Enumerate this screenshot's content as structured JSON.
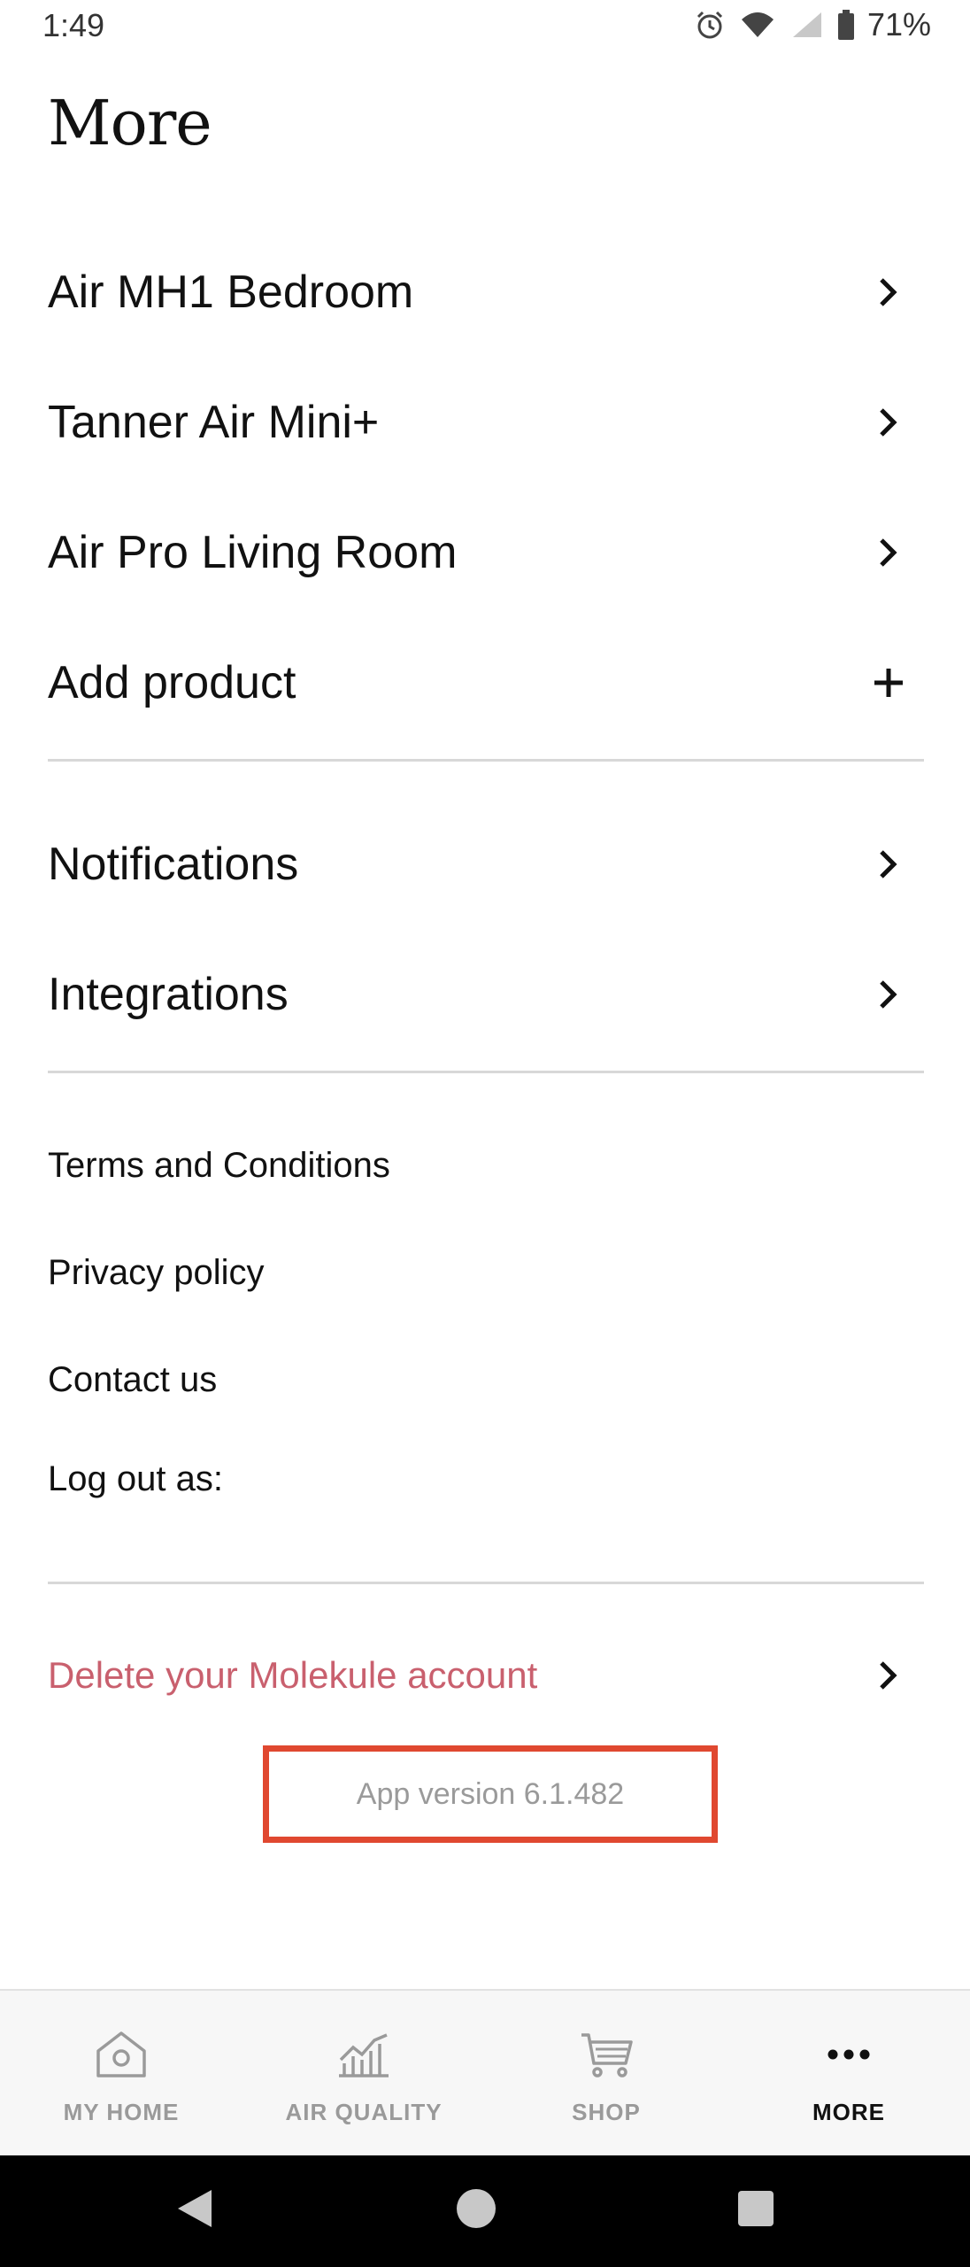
{
  "status_bar": {
    "time": "1:49",
    "battery": "71%",
    "icons": [
      "alarm-icon",
      "wifi-icon",
      "signal-icon",
      "battery-icon"
    ]
  },
  "page": {
    "title": "More"
  },
  "products": [
    {
      "label": "Air MH1 Bedroom",
      "icon": "chevron-right-icon"
    },
    {
      "label": "Tanner Air Mini+",
      "icon": "chevron-right-icon"
    },
    {
      "label": "Air Pro Living Room",
      "icon": "chevron-right-icon"
    },
    {
      "label": "Add product",
      "icon": "plus-icon"
    }
  ],
  "settings": [
    {
      "label": "Notifications",
      "icon": "chevron-right-icon"
    },
    {
      "label": "Integrations",
      "icon": "chevron-right-icon"
    }
  ],
  "links": [
    {
      "label": "Terms and Conditions"
    },
    {
      "label": "Privacy policy"
    },
    {
      "label": "Contact us"
    },
    {
      "label": "Log out as:"
    }
  ],
  "account": {
    "delete_label": "Delete your Molekule account",
    "delete_color": "#c9606e"
  },
  "app_version": "App version 6.1.482",
  "highlight_color": "#e04830",
  "bottom_nav": {
    "items": [
      {
        "label": "MY HOME",
        "icon": "home-icon",
        "active": false
      },
      {
        "label": "AIR QUALITY",
        "icon": "chart-icon",
        "active": false
      },
      {
        "label": "SHOP",
        "icon": "cart-icon",
        "active": false
      },
      {
        "label": "MORE",
        "icon": "more-dots-icon",
        "active": true
      }
    ]
  },
  "system_nav": {
    "icons": [
      "back-icon",
      "home-circle-icon",
      "recents-icon"
    ]
  }
}
